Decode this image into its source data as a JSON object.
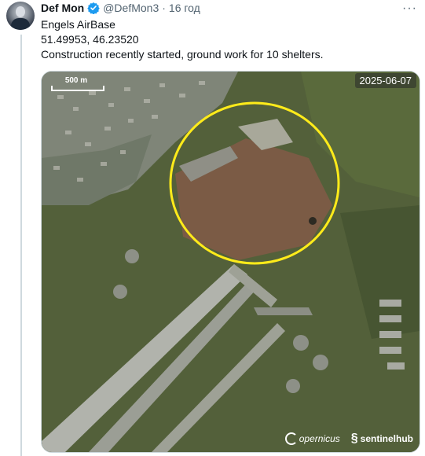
{
  "tweet": {
    "author_name": "Def Mon",
    "handle": "@DefMon3",
    "separator": "·",
    "time": "16 год",
    "more": "···",
    "lines": [
      "Engels AirBase",
      "51.49953, 46.23520",
      "Construction recently started, ground work for 10 shelters."
    ]
  },
  "media": {
    "date_label": "2025-06-07",
    "scale_label": "500 m",
    "credit_copernicus": "opernicus",
    "credit_sentinel": "sentinelhub"
  },
  "colors": {
    "verified": "#1d9bf0",
    "highlight_circle": "#ffeb1a",
    "terrain": "#4d5a36"
  }
}
